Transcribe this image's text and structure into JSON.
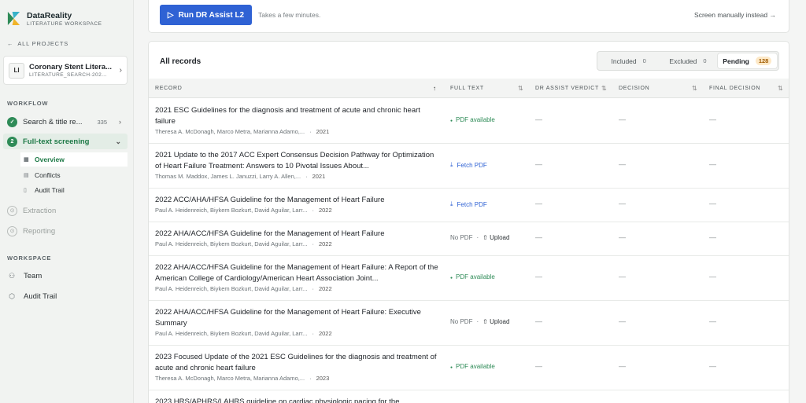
{
  "brand": {
    "name": "DataReality",
    "subtitle": "LITERATURE WORKSPACE"
  },
  "back_link": "ALL PROJECTS",
  "project": {
    "badge": "LI",
    "title": "Coronary Stent Litera...",
    "subtitle": "LITERATURE_SEARCH-202..."
  },
  "sidebar": {
    "workflow_label": "WORKFLOW",
    "search_item": {
      "label": "Search & title re...",
      "count": "335"
    },
    "fulltext_item": {
      "step": "2",
      "label": "Full-text screening"
    },
    "sub_items": {
      "overview": "Overview",
      "conflicts": "Conflicts",
      "audit": "Audit Trail"
    },
    "extraction": "Extraction",
    "reporting": "Reporting",
    "workspace_label": "WORKSPACE",
    "team": "Team",
    "audit_trail": "Audit Trail"
  },
  "top": {
    "run_label": "Run DR Assist L2",
    "note": "Takes a few minutes.",
    "manual_link": "Screen manually instead"
  },
  "records": {
    "title": "All records",
    "tabs": [
      {
        "label": "Included",
        "count": "0"
      },
      {
        "label": "Excluded",
        "count": "0"
      },
      {
        "label": "Pending",
        "count": "128"
      }
    ],
    "headers": {
      "record": "RECORD",
      "fulltext": "FULL TEXT",
      "verdict": "DR ASSIST VERDICT",
      "decision": "DECISION",
      "final": "FINAL DECISION"
    },
    "dash": "—",
    "upload": "Upload",
    "rows": [
      {
        "title": "2021 ESC Guidelines for the diagnosis and treatment of acute and chronic heart failure",
        "authors": "Theresa A. McDonagh, Marco Metra, Marianna Adamo,...",
        "year": "2021",
        "fulltext": "PDF available"
      },
      {
        "title": "2021 Update to the 2017 ACC Expert Consensus Decision Pathway for Optimization of Heart Failure Treatment: Answers to 10 Pivotal Issues About...",
        "authors": "Thomas M. Maddox, James L. Januzzi, Larry A. Allen,...",
        "year": "2021",
        "fulltext": "Fetch PDF"
      },
      {
        "title": "2022 ACC/AHA/HFSA Guideline for the Management of Heart Failure",
        "authors": "Paul A. Heidenreich, Biykem Bozkurt, David Aguilar, Larr...",
        "year": "2022",
        "fulltext": "Fetch PDF"
      },
      {
        "title": "2022 AHA/ACC/HFSA Guideline for the Management of Heart Failure",
        "authors": "Paul A. Heidenreich, Biykem Bozkurt, David Aguilar, Larr...",
        "year": "2022",
        "fulltext": "No PDF"
      },
      {
        "title": "2022 AHA/ACC/HFSA Guideline for the Management of Heart Failure: A Report of the American College of Cardiology/American Heart Association Joint...",
        "authors": "Paul A. Heidenreich, Biykem Bozkurt, David Aguilar, Larr...",
        "year": "2022",
        "fulltext": "PDF available"
      },
      {
        "title": "2022 AHA/ACC/HFSA Guideline for the Management of Heart Failure: Executive Summary",
        "authors": "Paul A. Heidenreich, Biykem Bozkurt, David Aguilar, Larr...",
        "year": "2022",
        "fulltext": "No PDF"
      },
      {
        "title": "2023 Focused Update of the 2021 ESC Guidelines for the diagnosis and treatment of acute and chronic heart failure",
        "authors": "Theresa A. McDonagh, Marco Metra, Marianna Adamo,...",
        "year": "2023",
        "fulltext": "PDF available"
      },
      {
        "title": "2023 HRS/APHRS/LAHRS guideline on cardiac physiologic pacing for the",
        "authors": "",
        "year": "",
        "fulltext": ""
      }
    ]
  }
}
